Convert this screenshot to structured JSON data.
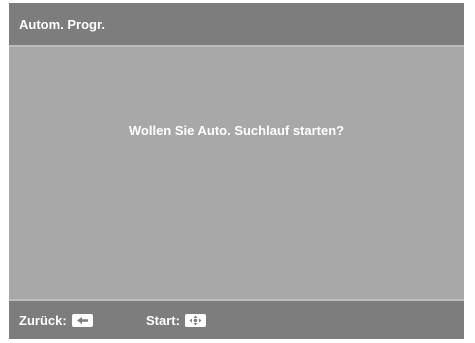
{
  "dialog": {
    "title": "Autom. Progr.",
    "message": "Wollen Sie Auto. Suchlauf starten?"
  },
  "footer": {
    "back_label": "Zurück:",
    "back_icon": "left-arrow-icon",
    "start_label": "Start:",
    "start_icon": "joystick-center-icon"
  },
  "colors": {
    "panel_background": "#a8a8a8",
    "bar_background": "#7d7d7d",
    "divider": "#bcbcbc",
    "text": "#ffffff"
  }
}
